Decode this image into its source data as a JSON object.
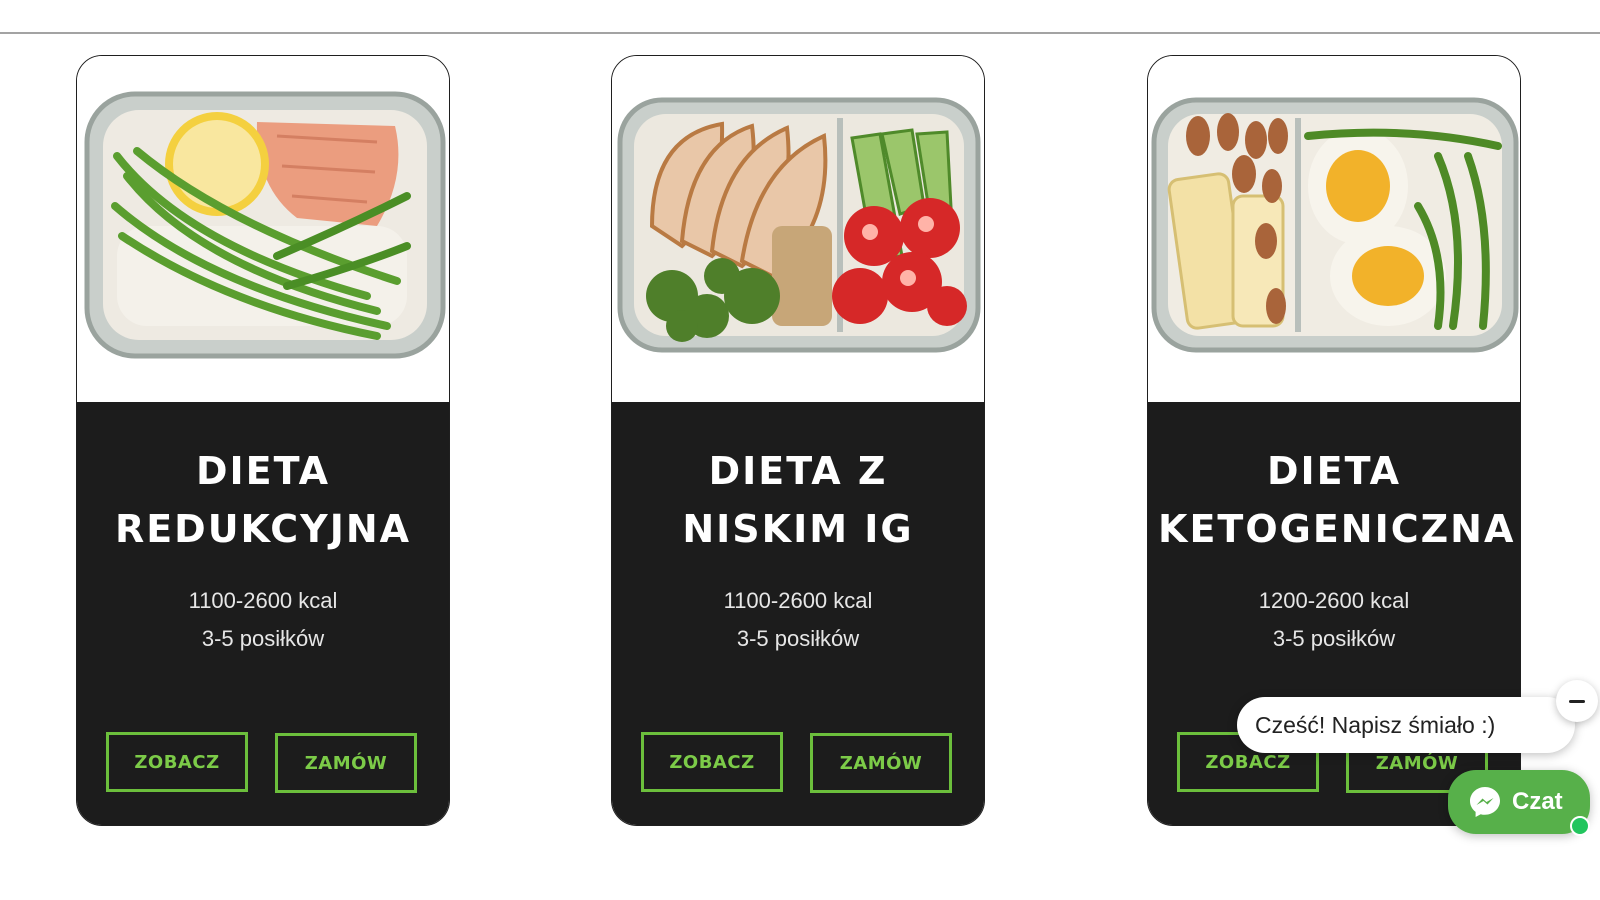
{
  "diets": [
    {
      "title": "DIETA REDUKCYJNA",
      "kcal": "1100-2600 kcal",
      "meals": "3-5 posiłków",
      "view_label": "ZOBACZ",
      "order_label": "ZAMÓW",
      "image_icon": "salmon-rice-asparagus-photo"
    },
    {
      "title": "DIETA Z NISKIM IG",
      "kcal": "1100-2600 kcal",
      "meals": "3-5 posiłków",
      "view_label": "ZOBACZ",
      "order_label": "ZAMÓW",
      "image_icon": "chicken-broccoli-tomato-photo"
    },
    {
      "title": "DIETA KETOGENICZNA",
      "kcal": "1200-2600 kcal",
      "meals": "3-5 posiłków",
      "view_label": "ZOBACZ",
      "order_label": "ZAMÓW",
      "image_icon": "almonds-egg-asparagus-photo"
    }
  ],
  "chat": {
    "greeting": "Cześć! Napisz śmiało :)",
    "button_label": "Czat",
    "icon": "messenger-icon"
  },
  "colors": {
    "card_background": "#1c1c1c",
    "button_border": "#6cbf3c",
    "chat_button": "#57b04a"
  }
}
